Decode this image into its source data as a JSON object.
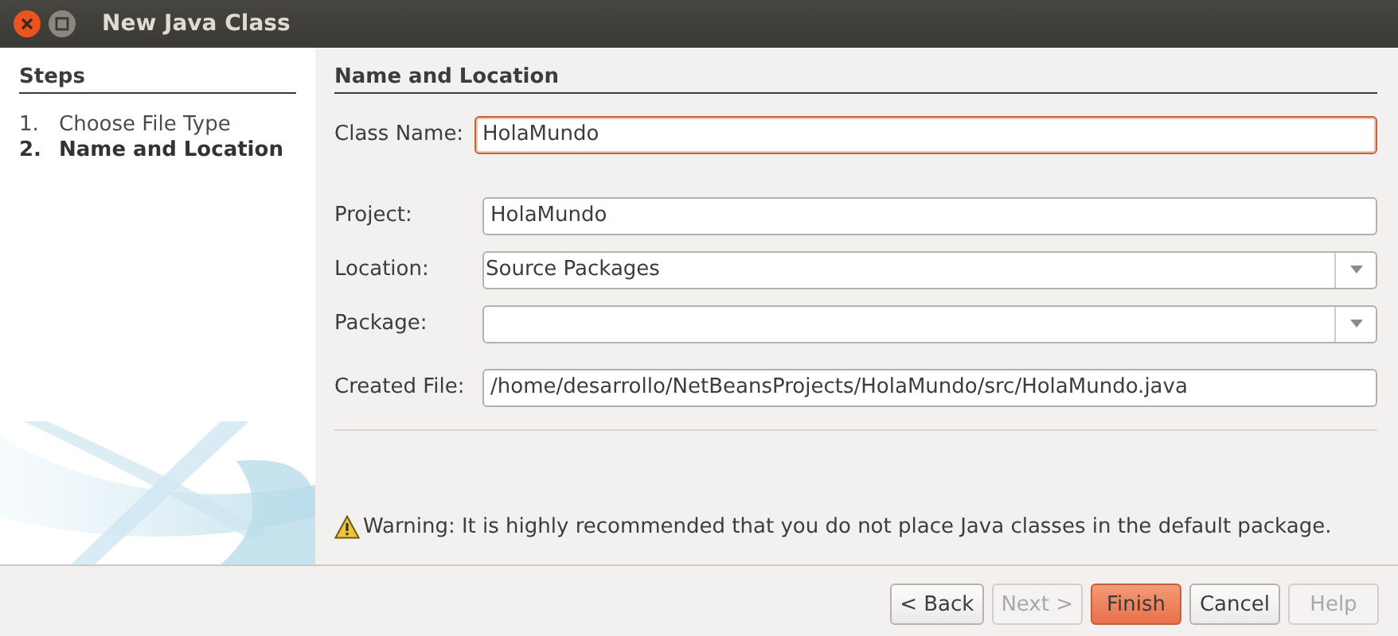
{
  "window": {
    "title": "New Java Class"
  },
  "steps": {
    "title": "Steps",
    "items": [
      {
        "number": "1.",
        "label": "Choose File Type",
        "selected": false
      },
      {
        "number": "2.",
        "label": "Name and Location",
        "selected": true
      }
    ]
  },
  "panel": {
    "title": "Name and Location",
    "class_field": {
      "kind": "text",
      "label": "Class Name:",
      "value": "HolaMundo",
      "focused": true
    },
    "fields": [
      {
        "kind": "text",
        "label": "Project:",
        "value": "HolaMundo",
        "focused": false
      },
      {
        "kind": "combo",
        "label": "Location:",
        "value": "Source Packages",
        "focused": false
      },
      {
        "kind": "combo",
        "label": "Package:",
        "focused": false
      },
      {
        "kind": "text",
        "label": "Created File:",
        "value": "/home/desarrollo/NetBeansProjects/HolaMundo/src/HolaMundo.java",
        "focused": false
      }
    ],
    "warning": "Warning: It is highly recommended that you do not place Java classes in the default package."
  },
  "buttons": [
    {
      "label": "< Back",
      "disabled": false,
      "default": false
    },
    {
      "label": "Next >",
      "disabled": true,
      "default": false
    },
    {
      "label": "Finish",
      "disabled": false,
      "default": true
    },
    {
      "label": "Cancel",
      "disabled": false,
      "default": false
    },
    {
      "label": "Help",
      "disabled": true,
      "default": false
    }
  ]
}
